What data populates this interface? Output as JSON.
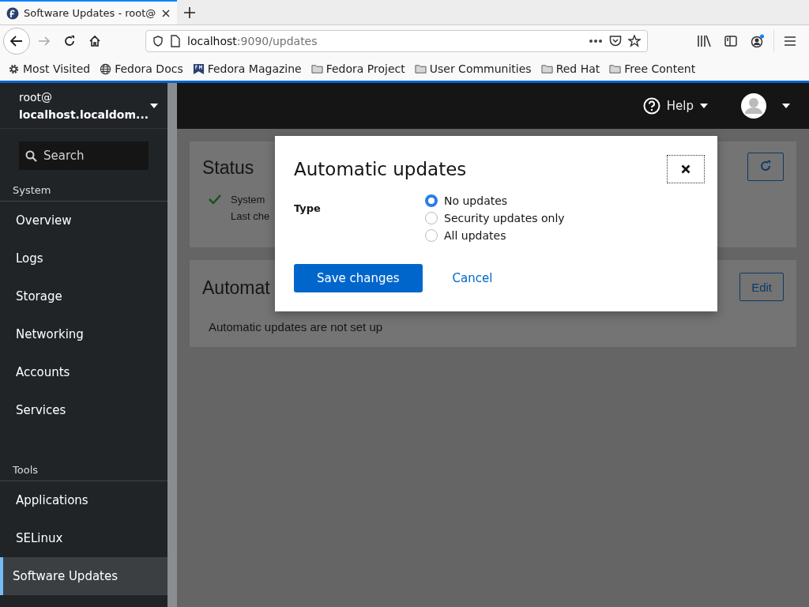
{
  "browser": {
    "tab": {
      "title": "Software Updates - root@"
    },
    "url": {
      "host": "localhost",
      "path": ":9090/updates"
    },
    "bookmarks": [
      {
        "label": "Most Visited",
        "kind": "gear"
      },
      {
        "label": "Fedora Docs",
        "kind": "globe"
      },
      {
        "label": "Fedora Magazine",
        "kind": "magazine"
      },
      {
        "label": "Fedora Project",
        "kind": "folder"
      },
      {
        "label": "User Communities",
        "kind": "folder"
      },
      {
        "label": "Red Hat",
        "kind": "folder"
      },
      {
        "label": "Free Content",
        "kind": "folder"
      }
    ]
  },
  "sidebar": {
    "host": {
      "user": "root@",
      "name": "localhost.localdom..."
    },
    "search": {
      "placeholder": "Search"
    },
    "sections": [
      {
        "title": "System",
        "items": [
          {
            "label": "Overview",
            "selected": false
          },
          {
            "label": "Logs",
            "selected": false
          },
          {
            "label": "Storage",
            "selected": false
          },
          {
            "label": "Networking",
            "selected": false
          },
          {
            "label": "Accounts",
            "selected": false
          },
          {
            "label": "Services",
            "selected": false
          }
        ]
      },
      {
        "title": "Tools",
        "items": [
          {
            "label": "Applications",
            "selected": false
          },
          {
            "label": "SELinux",
            "selected": false
          },
          {
            "label": "Software Updates",
            "selected": true
          }
        ]
      }
    ]
  },
  "topbar": {
    "help": "Help"
  },
  "status_card": {
    "title": "Status",
    "message": "System",
    "detail": "Last che"
  },
  "auto_card": {
    "title": "Automat",
    "message": "Automatic updates are not set up",
    "button": "Edit"
  },
  "dialog": {
    "title": "Automatic updates",
    "field_label": "Type",
    "options": [
      {
        "label": "No updates",
        "selected": true
      },
      {
        "label": "Security updates only",
        "selected": false
      },
      {
        "label": "All updates",
        "selected": false
      }
    ],
    "primary": "Save changes",
    "secondary": "Cancel"
  }
}
